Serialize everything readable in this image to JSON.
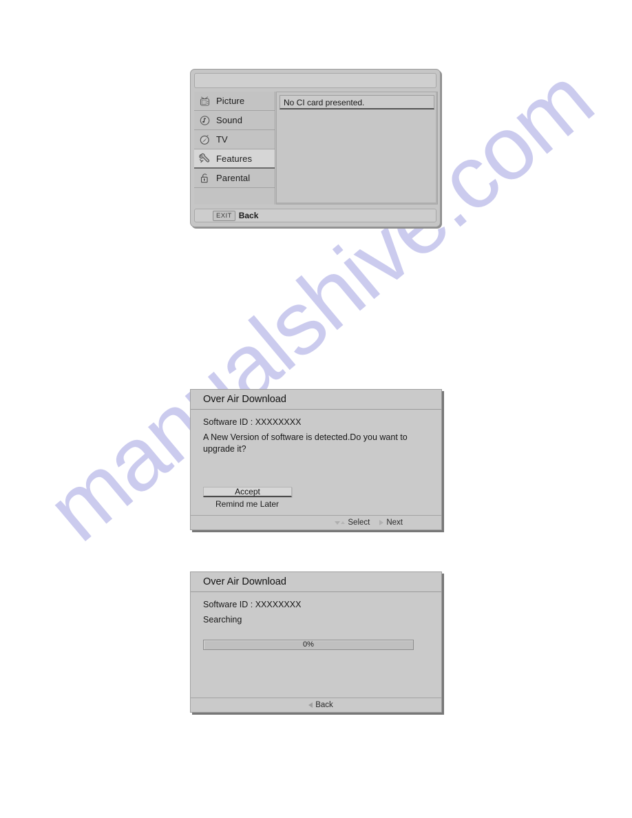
{
  "watermark": {
    "text": "manualshive.com",
    "color": "#c9c9ee"
  },
  "menu_dialog": {
    "title": "",
    "items": [
      {
        "label": "Picture",
        "icon": "television-icon",
        "selected": false
      },
      {
        "label": "Sound",
        "icon": "speaker-icon",
        "selected": false
      },
      {
        "label": "TV",
        "icon": "antenna-icon",
        "selected": false
      },
      {
        "label": "Features",
        "icon": "wrench-icon",
        "selected": true
      },
      {
        "label": "Parental",
        "icon": "lock-icon",
        "selected": false
      }
    ],
    "content": {
      "message": "No CI card presented."
    },
    "footer": {
      "key": "EXIT",
      "label": "Back"
    }
  },
  "oad_prompt": {
    "title": "Over Air Download",
    "software_id_line": "Software ID : XXXXXXXX",
    "message": "A New Version of software is detected.Do you want to upgrade it?",
    "accept_label": "Accept",
    "remind_label": "Remind me Later",
    "footer": {
      "select_label": "Select",
      "next_label": "Next"
    }
  },
  "oad_progress": {
    "title": "Over Air Download",
    "software_id_line": "Software ID : XXXXXXXX",
    "status": "Searching",
    "progress": {
      "percent": 0,
      "label": "0%"
    },
    "footer": {
      "back_label": "Back"
    }
  }
}
